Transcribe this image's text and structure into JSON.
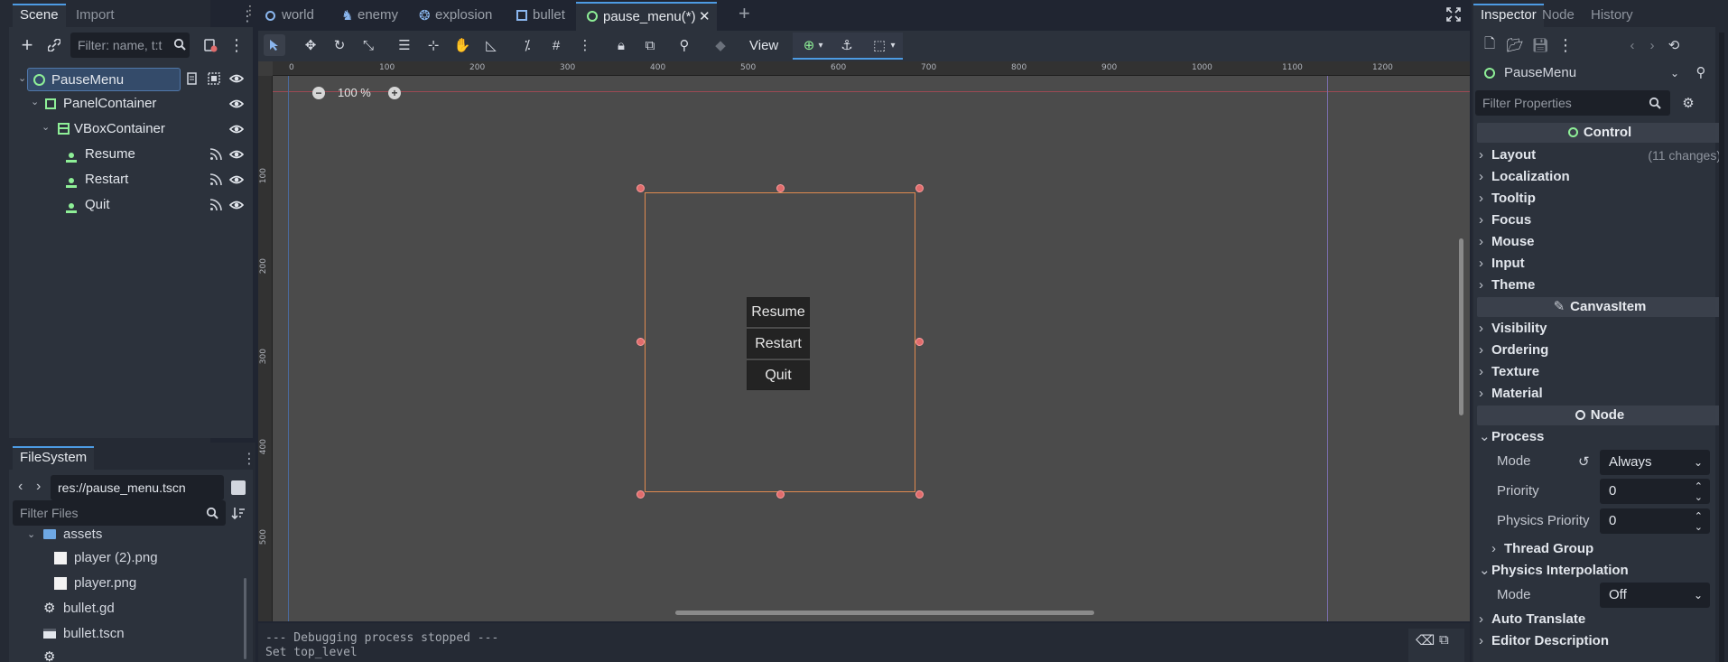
{
  "scene_dock": {
    "tabs": [
      "Scene",
      "Import"
    ],
    "filter_placeholder": "Filter: name, t:t",
    "tree": [
      {
        "label": "PauseMenu",
        "icon": "control-icon"
      },
      {
        "label": "PanelContainer",
        "icon": "panel-container-icon"
      },
      {
        "label": "VBoxContainer",
        "icon": "vbox-container-icon"
      },
      {
        "label": "Resume",
        "icon": "button-icon"
      },
      {
        "label": "Restart",
        "icon": "button-icon"
      },
      {
        "label": "Quit",
        "icon": "button-icon"
      }
    ]
  },
  "filesystem_dock": {
    "tab": "FileSystem",
    "path": "res://pause_menu.tscn",
    "filter_placeholder": "Filter Files",
    "items": [
      {
        "label": "assets",
        "icon": "folder-icon"
      },
      {
        "label": "player (2).png",
        "icon": "image-file-icon"
      },
      {
        "label": "player.png",
        "icon": "image-file-icon"
      },
      {
        "label": "bullet.gd",
        "icon": "gear-icon"
      },
      {
        "label": "bullet.tscn",
        "icon": "scene-file-icon"
      }
    ]
  },
  "editor_tabs": [
    "world",
    "enemy",
    "explosion",
    "bullet",
    "pause_menu(*)"
  ],
  "toolbar": {
    "view_label": "View"
  },
  "viewport": {
    "zoom_label": "100 %",
    "ruler_x": [
      "0",
      "100",
      "200",
      "300",
      "400",
      "500",
      "600",
      "700",
      "800",
      "900",
      "1000",
      "1100",
      "1200"
    ],
    "ruler_y": [
      "100",
      "200",
      "300",
      "400",
      "500"
    ],
    "buttons": [
      "Resume",
      "Restart",
      "Quit"
    ]
  },
  "output": {
    "lines": [
      "--- Debugging process stopped ---",
      "Set top_level"
    ]
  },
  "inspector": {
    "tabs": [
      "Inspector",
      "Node",
      "History"
    ],
    "node_name": "PauseMenu",
    "filter_placeholder": "Filter Properties",
    "sections": {
      "control": "Control",
      "canvas_item": "CanvasItem",
      "node": "Node"
    },
    "layout_label": "Layout",
    "layout_changes": "(11 changes)",
    "control_props": [
      "Localization",
      "Tooltip",
      "Focus",
      "Mouse",
      "Input",
      "Theme"
    ],
    "canvas_props": [
      "Visibility",
      "Ordering",
      "Texture",
      "Material"
    ],
    "process": {
      "label": "Process",
      "mode_key": "Mode",
      "mode_value": "Always",
      "priority_key": "Priority",
      "priority_value": "0",
      "physics_priority_key": "Physics Priority",
      "physics_priority_value": "0",
      "thread_group": "Thread Group"
    },
    "physics_interpolation": {
      "label": "Physics Interpolation",
      "mode_key": "Mode",
      "mode_value": "Off"
    },
    "auto_translate": "Auto Translate",
    "editor_description": "Editor Description"
  },
  "colors": {
    "accent": "#4d9be3",
    "selection_rect": "#e08a50",
    "handle": "#e06c6c",
    "control_green": "#8eef97"
  }
}
